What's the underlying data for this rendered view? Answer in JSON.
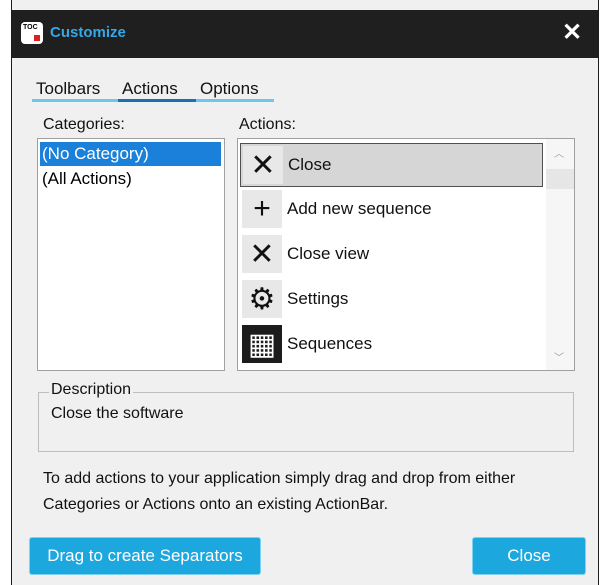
{
  "window": {
    "title": "Customize",
    "app_icon_text": "TOC",
    "close_glyph": "✕"
  },
  "tabs": [
    {
      "label": "Toolbars"
    },
    {
      "label": "Actions",
      "active": true
    },
    {
      "label": "Options"
    }
  ],
  "categories": {
    "label": "Categories:",
    "items": [
      {
        "label": "(No Category)",
        "selected": true
      },
      {
        "label": "(All Actions)"
      }
    ]
  },
  "actions": {
    "label": "Actions:",
    "items": [
      {
        "label": "Close",
        "icon": "close-icon",
        "glyph": "✕",
        "selected": true
      },
      {
        "label": "Add new sequence",
        "icon": "plus-icon",
        "glyph": "+"
      },
      {
        "label": "Close view",
        "icon": "close-view-icon",
        "glyph": "✕"
      },
      {
        "label": "Settings",
        "icon": "gear-icon",
        "glyph": "⚙"
      },
      {
        "label": "Sequences",
        "icon": "sequences-icon",
        "glyph": "▦"
      }
    ],
    "scroll_up": "︿",
    "scroll_down": "﹀"
  },
  "description": {
    "legend": "Description",
    "text": "Close the software"
  },
  "help_text": "To add actions to your application simply drag and drop from either Categories or Actions onto an existing ActionBar.",
  "buttons": {
    "separator_label": "Drag to create Separators",
    "close_label": "Close"
  },
  "colors": {
    "accent": "#1da7df",
    "title": "#35a7e6",
    "selection": "#1a80d9"
  }
}
